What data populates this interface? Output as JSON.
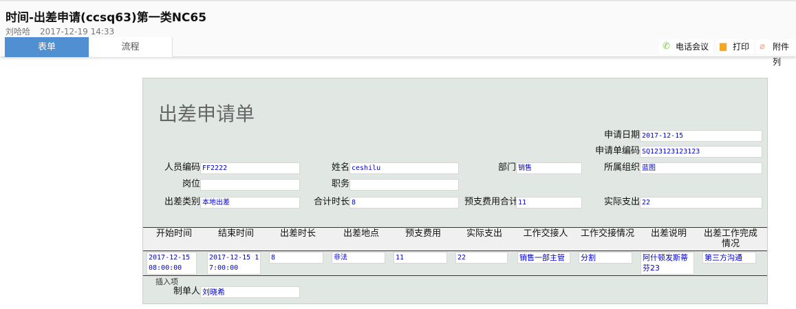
{
  "header": {
    "title": "时间-出差申请(ccsq63)第一类NC65",
    "author": "刘哈哈",
    "datetime": "2017-12-19 14:33"
  },
  "tabs": [
    {
      "label": "表单"
    },
    {
      "label": "流程"
    }
  ],
  "toolbar": {
    "phone": "电话会议",
    "print": "打印",
    "attach": "附件列"
  },
  "form": {
    "title": "出差申请单",
    "apply_date_label": "申请日期",
    "apply_date": "2017-12-15",
    "code_label": "申请单编码",
    "code": "SQ123123123123",
    "emp_code_label": "人员编码",
    "emp_code": "FF2222",
    "name_label": "姓名",
    "name": "ceshilu",
    "dept_label": "部门",
    "dept": "销售",
    "org_label": "所属组织",
    "org": "蓝图",
    "post_label": "岗位",
    "post": "",
    "duty_label": "职务",
    "duty": "",
    "type_label": "出差类别",
    "type": "本地出差",
    "total_hours_label": "合计时长",
    "total_hours": "8",
    "advance_total_label": "预支费用合计",
    "advance_total": "11",
    "actual_label": "实际支出",
    "actual": "22",
    "columns": [
      "开始时间",
      "结束时间",
      "出差时长",
      "出差地点",
      "预支费用",
      "实际支出",
      "工作交接人",
      "工作交接情况",
      "出差说明",
      "出差工作完成情况"
    ],
    "rows": [
      [
        "2017-12-15 08:00:00",
        "2017-12-15 17:00:00",
        "8",
        "非法",
        "11",
        "22",
        "销售一部主管",
        "分割",
        "阿什顿发斯蒂芬23",
        "第三方沟通"
      ]
    ],
    "insert_label": "插入项",
    "maker_label": "制单人",
    "maker": "刘晓希"
  }
}
